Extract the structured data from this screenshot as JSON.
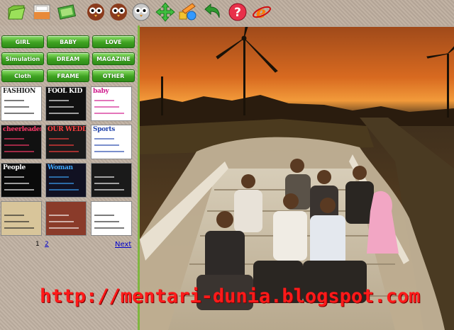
{
  "toolbar": {
    "buttons": [
      {
        "name": "open-folder-icon",
        "color": "#7cc33b"
      },
      {
        "name": "save-icon",
        "color": "#e88a3a"
      },
      {
        "name": "photo-icon",
        "color": "#4caa3c"
      },
      {
        "name": "owl-icon-1",
        "color": "#8a3b1c"
      },
      {
        "name": "owl-icon-2",
        "color": "#8a3b1c"
      },
      {
        "name": "owl-icon-3",
        "color": "#b0b0b0"
      },
      {
        "name": "move-arrows-icon",
        "color": "#3fbf3f"
      },
      {
        "name": "pencil-shapes-icon",
        "color": "#3399ff"
      },
      {
        "name": "undo-icon",
        "color": "#2f9a2f"
      },
      {
        "name": "help-icon",
        "color": "#e8304a"
      },
      {
        "name": "ie-icon",
        "color": "#ff7a00"
      }
    ]
  },
  "categories": [
    "GIRL",
    "BABY",
    "LOVE",
    "Simulation",
    "DREAM",
    "MAGAZINE",
    "Cloth",
    "FRAME",
    "OTHER"
  ],
  "thumbnails": [
    {
      "title": "FASHION",
      "bg": "#ffffff",
      "fg": "#222222"
    },
    {
      "title": "FOOL KID",
      "bg": "#111111",
      "fg": "#ffffff"
    },
    {
      "title": "baby",
      "bg": "#ffffff",
      "fg": "#d0198c"
    },
    {
      "title": "cheerleader",
      "bg": "#111111",
      "fg": "#ff3b6b"
    },
    {
      "title": "OUR WEDDING",
      "bg": "#1a1a1a",
      "fg": "#ff4040"
    },
    {
      "title": "Sports",
      "bg": "#ffffff",
      "fg": "#2244aa"
    },
    {
      "title": "People",
      "bg": "#0a0a0a",
      "fg": "#ffffff"
    },
    {
      "title": "Woman",
      "bg": "#111122",
      "fg": "#3fa9ff"
    },
    {
      "title": "",
      "bg": "#1a1a1a",
      "fg": "#ffffff"
    },
    {
      "title": "",
      "bg": "#d8c59a",
      "fg": "#222222"
    },
    {
      "title": "",
      "bg": "#8a3b2a",
      "fg": "#ffffff"
    },
    {
      "title": "",
      "bg": "#ffffff",
      "fg": "#222222"
    }
  ],
  "pager": {
    "page1": "1",
    "page2": "2",
    "next": "Next"
  },
  "watermark": "http://mentari-dunia.blogspot.com"
}
